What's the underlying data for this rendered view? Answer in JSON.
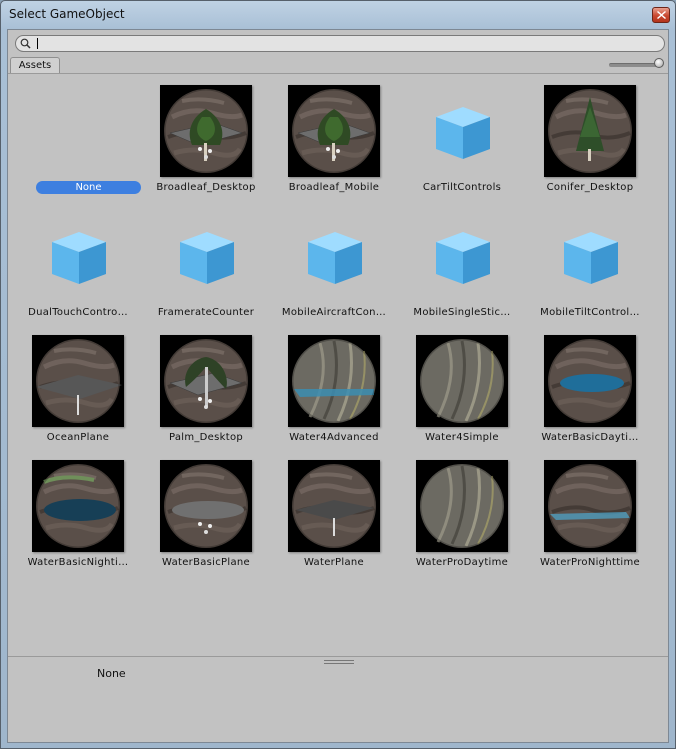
{
  "window": {
    "title": "Select GameObject"
  },
  "search": {
    "value": "",
    "placeholder": ""
  },
  "tabs": [
    {
      "label": "Assets"
    }
  ],
  "zoom_level": 1.0,
  "items": [
    {
      "label": "None",
      "kind": "none",
      "selected": true
    },
    {
      "label": "Broadleaf_Desktop",
      "kind": "tree"
    },
    {
      "label": "Broadleaf_Mobile",
      "kind": "tree"
    },
    {
      "label": "CarTiltControls",
      "kind": "cube"
    },
    {
      "label": "Conifer_Desktop",
      "kind": "conifer"
    },
    {
      "label": "DualTouchContro…",
      "kind": "cube"
    },
    {
      "label": "FramerateCounter",
      "kind": "cube"
    },
    {
      "label": "MobileAircraftCon…",
      "kind": "cube"
    },
    {
      "label": "MobileSingleStic…",
      "kind": "cube"
    },
    {
      "label": "MobileTiltControl…",
      "kind": "cube"
    },
    {
      "label": "OceanPlane",
      "kind": "plane"
    },
    {
      "label": "Palm_Desktop",
      "kind": "palm"
    },
    {
      "label": "Water4Advanced",
      "kind": "water-blue"
    },
    {
      "label": "Water4Simple",
      "kind": "water-simple"
    },
    {
      "label": "WaterBasicDayti…",
      "kind": "water-ellipse"
    },
    {
      "label": "WaterBasicNighti…",
      "kind": "water-ellipse-dark"
    },
    {
      "label": "WaterBasicPlane",
      "kind": "water-ellipse-gray"
    },
    {
      "label": "WaterPlane",
      "kind": "plane-dark"
    },
    {
      "label": "WaterProDaytime",
      "kind": "water-simple"
    },
    {
      "label": "WaterProNighttime",
      "kind": "water-blue-thin"
    }
  ],
  "footer": {
    "selected_name": "None"
  },
  "colors": {
    "selection": "#3d7fe0",
    "client_bg": "#c2c2c2",
    "cube": "#5bb3ea"
  }
}
